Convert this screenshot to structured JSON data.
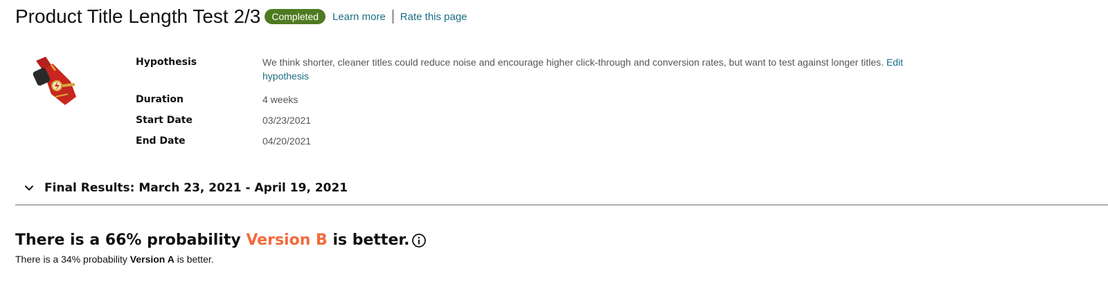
{
  "header": {
    "title": "Product Title Length Test 2/3",
    "status_badge": "Completed",
    "learn_more": "Learn more",
    "rate_page": "Rate this page"
  },
  "details": {
    "hypothesis_label": "Hypothesis",
    "hypothesis_text": "We think shorter, cleaner titles could reduce noise and encourage higher click-through and conversion rates, but want to test against longer titles.",
    "edit_link_1": "Edit",
    "edit_link_2": "hypothesis",
    "duration_label": "Duration",
    "duration_value": "4 weeks",
    "start_label": "Start Date",
    "start_value": "03/23/2021",
    "end_label": "End Date",
    "end_value": "04/20/2021"
  },
  "results": {
    "title": "Final Results: March 23, 2021 - April 19, 2021",
    "headline_prefix": "There is a 66% probability",
    "headline_version": "Version B",
    "headline_suffix": "is better.",
    "sub_prefix": "There is a 34% probability",
    "sub_version": "Version A",
    "sub_suffix": "is better."
  },
  "icons": {
    "product_image": "smartwatch-band-image",
    "chevron": "chevron-down-icon",
    "info": "info-icon"
  },
  "colors": {
    "status_green": "#4f7a21",
    "link": "#1b6e84",
    "version_b": "#f26a3c"
  }
}
